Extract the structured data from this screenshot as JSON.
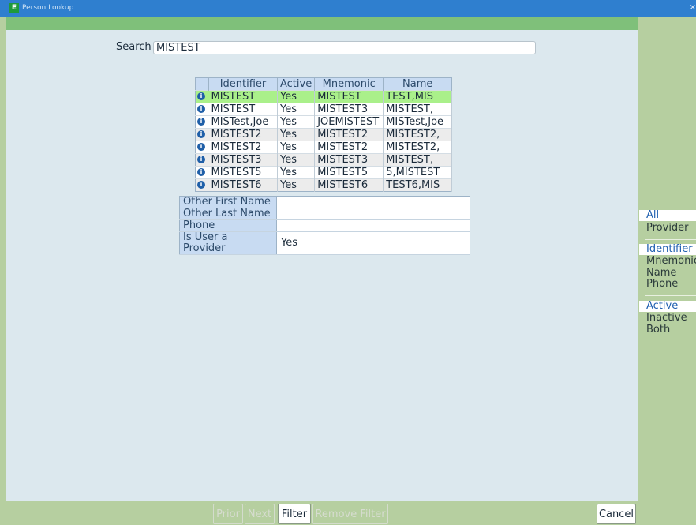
{
  "window": {
    "title": "Person Lookup",
    "close_glyph": "×",
    "app_icon": "E"
  },
  "search": {
    "label": "Search",
    "value": "MISTEST"
  },
  "results": {
    "columns": [
      "Identifier",
      "Active",
      "Mnemonic",
      "Name"
    ],
    "rows": [
      {
        "identifier": "MISTEST",
        "active": "Yes",
        "mnemonic": "MISTEST",
        "name": "TEST,MIS"
      },
      {
        "identifier": "MISTEST",
        "active": "Yes",
        "mnemonic": "MISTEST3",
        "name": "MISTEST,"
      },
      {
        "identifier": "MISTest,Joe",
        "active": "Yes",
        "mnemonic": "JOEMISTEST",
        "name": "MISTest,Joe"
      },
      {
        "identifier": "MISTEST2",
        "active": "Yes",
        "mnemonic": "MISTEST2",
        "name": "MISTEST2,"
      },
      {
        "identifier": "MISTEST2",
        "active": "Yes",
        "mnemonic": "MISTEST2",
        "name": "MISTEST2,"
      },
      {
        "identifier": "MISTEST3",
        "active": "Yes",
        "mnemonic": "MISTEST3",
        "name": "MISTEST,"
      },
      {
        "identifier": "MISTEST5",
        "active": "Yes",
        "mnemonic": "MISTEST5",
        "name": "5,MISTEST"
      },
      {
        "identifier": "MISTEST6",
        "active": "Yes",
        "mnemonic": "MISTEST6",
        "name": "TEST6,MIS"
      }
    ]
  },
  "details": [
    {
      "label": "Other First Name",
      "value": ""
    },
    {
      "label": "Other Last Name",
      "value": ""
    },
    {
      "label": "Phone",
      "value": ""
    },
    {
      "label": "Is User a Provider",
      "value": "Yes"
    }
  ],
  "sidebar": {
    "type_filter": [
      "All",
      "Provider"
    ],
    "search_by": [
      "Identifier",
      "Mnemonic",
      "Name",
      "Phone"
    ],
    "status": [
      "Active",
      "Inactive",
      "Both"
    ]
  },
  "buttons": {
    "prior": "Prior",
    "next": "Next",
    "filter": "Filter",
    "remove_filter": "Remove Filter",
    "cancel": "Cancel"
  },
  "colors": {
    "titlebar": "#2f7fcf",
    "accent_green": "#7fc07a",
    "selected_row": "#aaf08a",
    "panel": "#dce8ee",
    "sidebar": "#b6cfa0"
  }
}
